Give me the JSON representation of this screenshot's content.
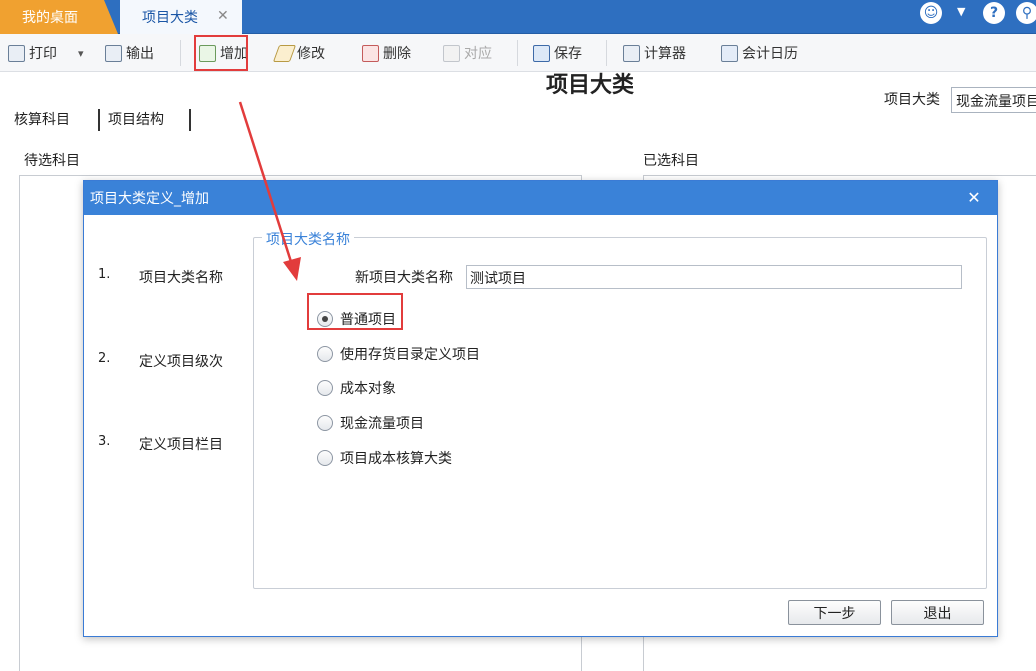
{
  "tabs": {
    "home": "我的桌面",
    "active": "项目大类",
    "close_glyph": "✕"
  },
  "header_icons": {
    "smiley": "☺",
    "caret": "▼",
    "help": "?",
    "user": "⚲"
  },
  "toolbar": {
    "print": "打印",
    "print_dropdown": "▾",
    "export": "输出",
    "add": "增加",
    "edit": "修改",
    "delete": "删除",
    "match": "对应",
    "save": "保存",
    "calculator": "计算器",
    "calendar": "会计日历"
  },
  "page": {
    "title": "项目大类",
    "category_label": "项目大类",
    "category_value": "现金流量项目",
    "subtabs": [
      "核算科目",
      "项目结构"
    ],
    "left_pane_label": "待选科目",
    "right_pane_label": "已选科目"
  },
  "dialog": {
    "title": "项目大类定义_增加",
    "close_glyph": "✕",
    "steps": [
      {
        "num": "1.",
        "label": "项目大类名称"
      },
      {
        "num": "2.",
        "label": "定义项目级次"
      },
      {
        "num": "3.",
        "label": "定义项目栏目"
      }
    ],
    "group_legend": "项目大类名称",
    "name_label": "新项目大类名称",
    "name_value": "测试项目",
    "options": [
      {
        "label": "普通项目",
        "checked": true
      },
      {
        "label": "使用存货目录定义项目",
        "checked": false
      },
      {
        "label": "成本对象",
        "checked": false
      },
      {
        "label": "现金流量项目",
        "checked": false
      },
      {
        "label": "项目成本核算大类",
        "checked": false
      }
    ],
    "next_button": "下一步",
    "exit_button": "退出"
  },
  "colors": {
    "tab_bar": "#2e6fc0",
    "home_tab": "#f0a130",
    "dialog_header": "#3a82d8",
    "annotation": "#e23c3c"
  }
}
